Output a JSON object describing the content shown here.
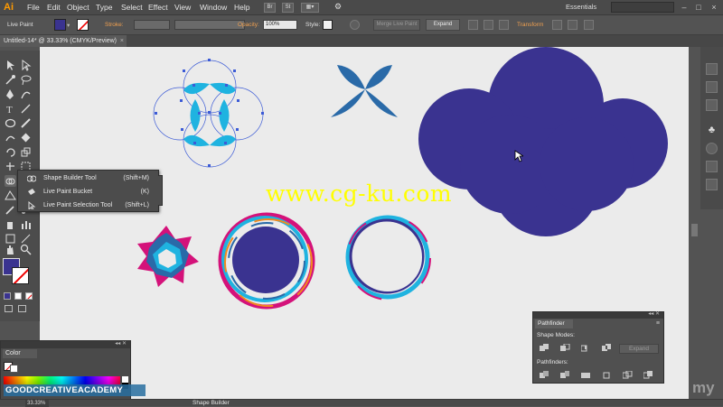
{
  "app": {
    "logo": "Ai"
  },
  "menu": [
    "File",
    "Edit",
    "Object",
    "Type",
    "Select",
    "Effect",
    "View",
    "Window",
    "Help"
  ],
  "toolbar_buttons": {
    "br": "Br",
    "st": "St"
  },
  "workspace": "Essentials",
  "control_bar": {
    "tool_label": "Live Paint",
    "stroke_label": "Stroke:",
    "opacity_label": "Opacity:",
    "opacity_value": "100%",
    "style_label": "Style:",
    "merge_button": "Merge Live Paint",
    "expand_button": "Expand",
    "transform_label": "Transform",
    "fill_color": "#3a3390"
  },
  "document": {
    "tab_title": "Untitled-14* @ 33.33% (CMYK/Preview)",
    "close": "×"
  },
  "flyout": {
    "items": [
      {
        "label": "Shape Builder Tool",
        "shortcut": "(Shift+M)"
      },
      {
        "label": "Live Paint Bucket",
        "shortcut": "(K)"
      },
      {
        "label": "Live Paint Selection Tool",
        "shortcut": "(Shift+L)"
      }
    ]
  },
  "color_panel": {
    "title": "Color"
  },
  "pathfinder": {
    "title": "Pathfinder",
    "shape_modes_label": "Shape Modes:",
    "pathfinders_label": "Pathfinders:",
    "expand_button": "Expand"
  },
  "status": {
    "zoom": "33.33%",
    "tool": "Shape Builder"
  },
  "watermark": "www.cg-ku.com",
  "brand": "GOODCREATIVEACADEMY",
  "udemy": "my",
  "colors": {
    "navy": "#3a3390",
    "cyan": "#1fb3e0",
    "steel_blue": "#2a6aa8",
    "magenta": "#d4127a",
    "orange": "#f08a1e",
    "canvas": "#ebebeb",
    "selection": "#3c5bd6"
  }
}
